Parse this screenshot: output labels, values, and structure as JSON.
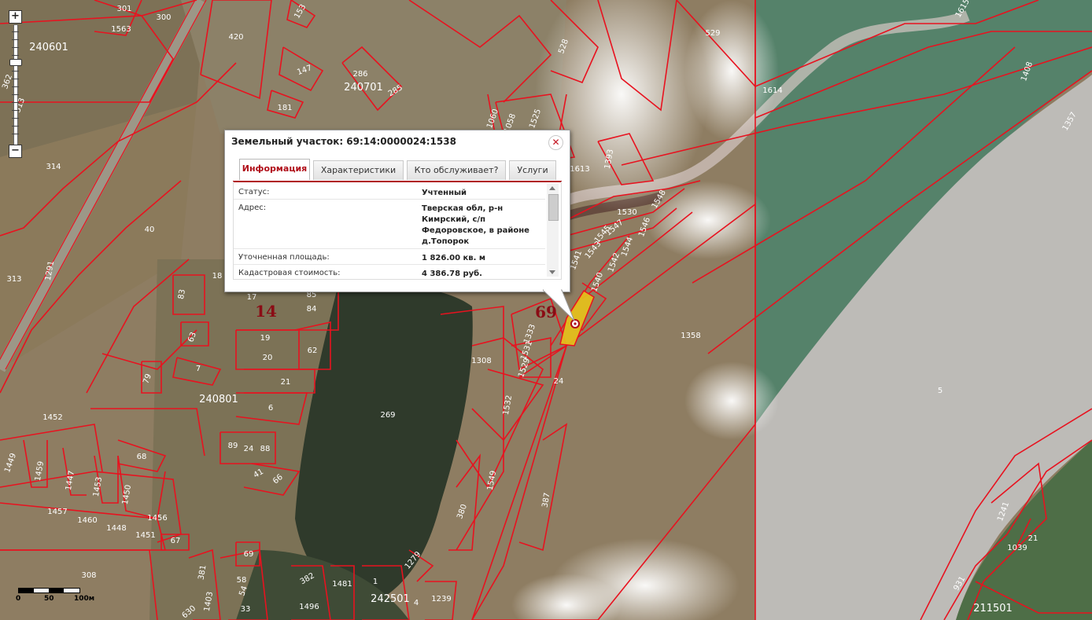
{
  "popup": {
    "title": "Земельный участок: 69:14:0000024:1538",
    "close_icon": "close-icon",
    "tabs": [
      {
        "label": "Информация",
        "active": true
      },
      {
        "label": "Характеристики",
        "active": false
      },
      {
        "label": "Кто обслуживает?",
        "active": false
      },
      {
        "label": "Услуги",
        "active": false
      }
    ],
    "rows": [
      {
        "label": "Статус:",
        "value": "Учтенный"
      },
      {
        "label": "Адрес:",
        "value": "Тверская обл, р-н Кимрский, с/п Федоровское, в районе д.Топорок"
      },
      {
        "label": "Уточненная площадь:",
        "value": "1 826.00 кв. м"
      },
      {
        "label": "Кадастровая стоимость:",
        "value": "4 386.78 руб."
      }
    ]
  },
  "zoom": {
    "plus": "+",
    "minus": "−"
  },
  "scale": {
    "labels": [
      "0",
      "50",
      "100м"
    ]
  },
  "colors": {
    "boundary": "#e8121f",
    "accent": "#b00d18",
    "selected": "#e8c21a"
  },
  "map": {
    "district_labels": [
      "69",
      "14"
    ],
    "block_labels": [
      "240601",
      "240701",
      "240801",
      "242501",
      "211501"
    ],
    "parcel_labels": [
      "301",
      "300",
      "153",
      "1563",
      "420",
      "529",
      "528",
      "1615",
      "1614",
      "1408",
      "1357",
      "286",
      "147",
      "285",
      "181",
      "1060",
      "1058",
      "1525",
      "1613",
      "1393",
      "1548",
      "1530",
      "1547",
      "1545",
      "1546",
      "1543",
      "1544",
      "1542",
      "1541",
      "1540",
      "1358",
      "314",
      "40",
      "1291",
      "313",
      "18",
      "17",
      "85",
      "84",
      "83",
      "63",
      "19",
      "20",
      "62",
      "79",
      "7",
      "21",
      "6",
      "1333",
      "1531",
      "1529",
      "1308",
      "1532",
      "24",
      "269",
      "5",
      "1452",
      "1449",
      "1459",
      "1447",
      "1453",
      "1450",
      "1456",
      "1457",
      "1460",
      "1448",
      "1451",
      "68",
      "89",
      "24",
      "88",
      "41",
      "66",
      "67",
      "69",
      "308",
      "381",
      "1403",
      "58",
      "54",
      "33",
      "630",
      "382",
      "1481",
      "1",
      "1239",
      "1496",
      "4",
      "380",
      "1549",
      "387",
      "1279",
      "1241",
      "1039",
      "21",
      "931",
      "362",
      "313"
    ]
  }
}
